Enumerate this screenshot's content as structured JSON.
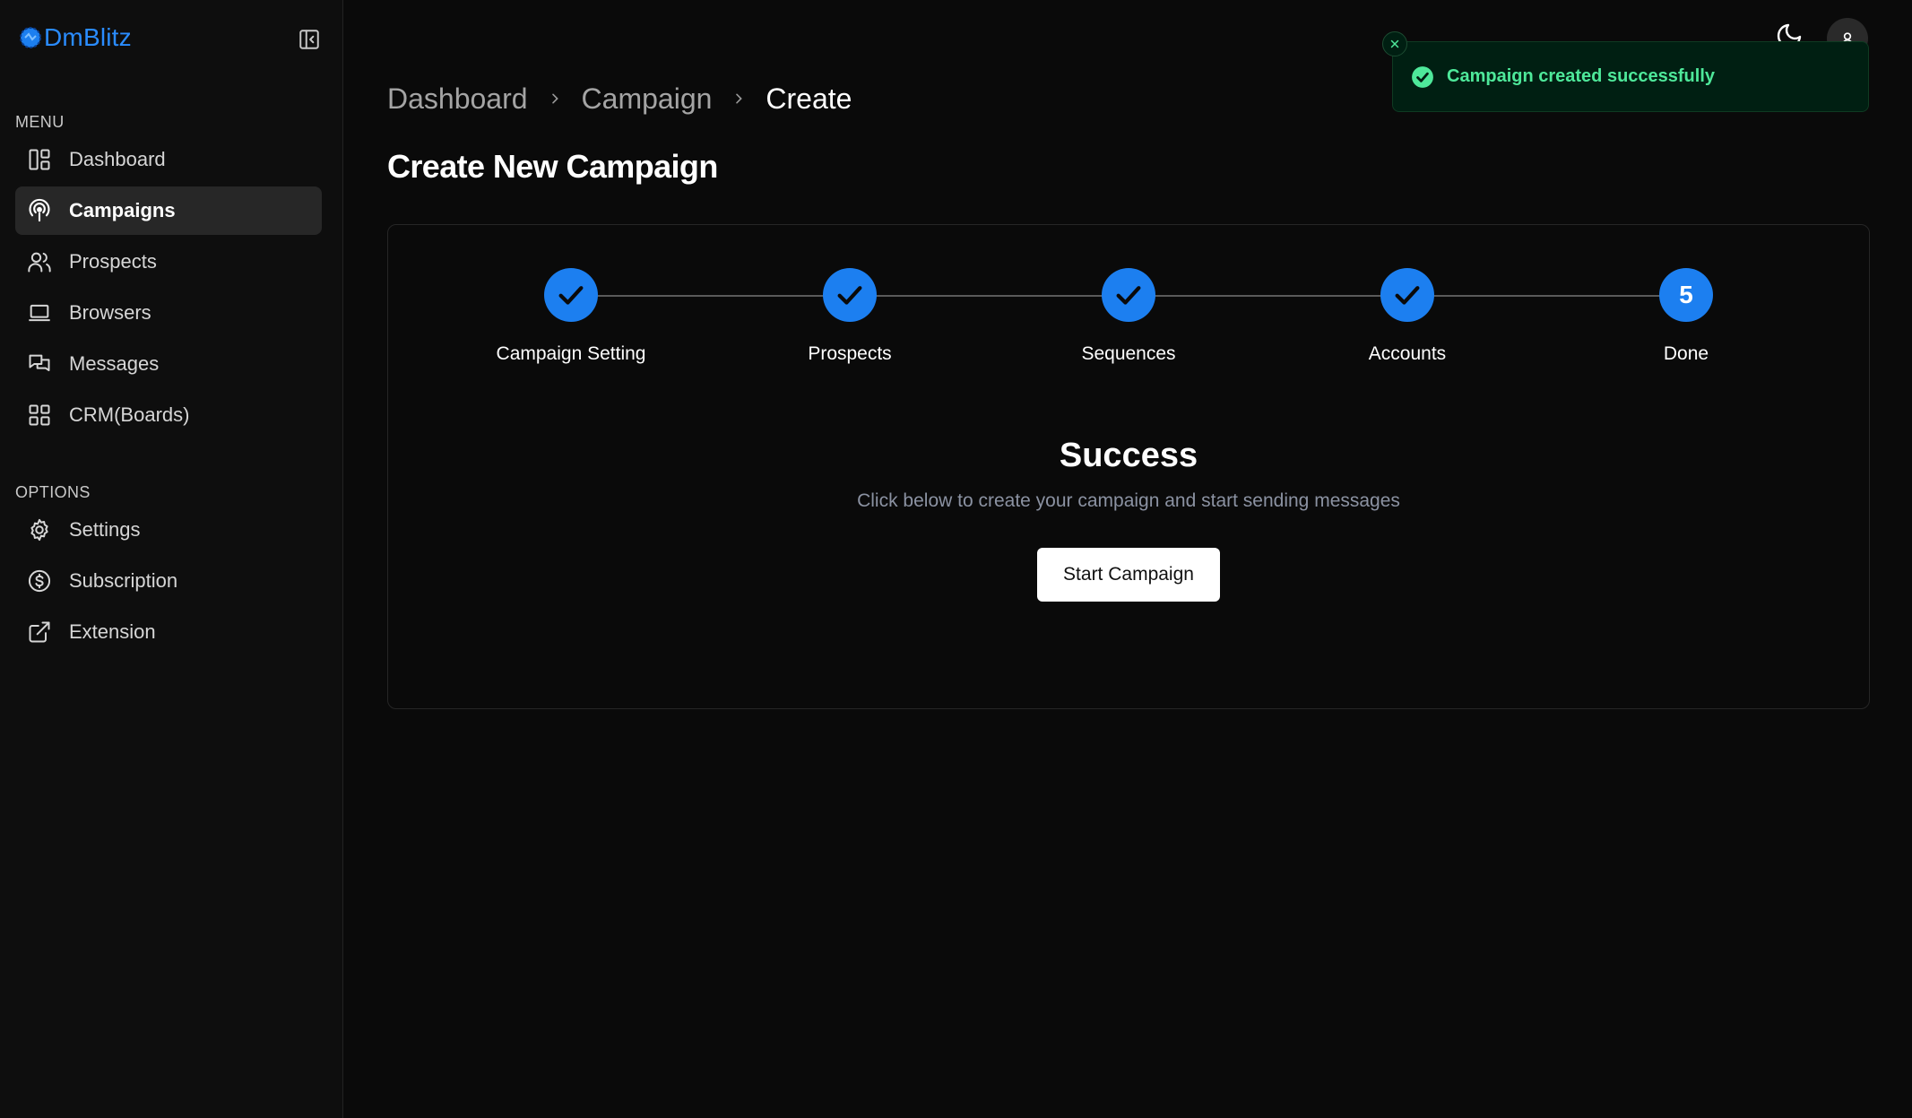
{
  "brand": {
    "name": "DmBlitz",
    "color": "#2a8cff"
  },
  "sidebar": {
    "menu_label": "MENU",
    "options_label": "OPTIONS",
    "menu_items": [
      {
        "label": "Dashboard",
        "icon": "layout-dashboard-icon",
        "active": false
      },
      {
        "label": "Campaigns",
        "icon": "podcast-icon",
        "active": true
      },
      {
        "label": "Prospects",
        "icon": "users-icon",
        "active": false
      },
      {
        "label": "Browsers",
        "icon": "laptop-icon",
        "active": false
      },
      {
        "label": "Messages",
        "icon": "messages-icon",
        "active": false
      },
      {
        "label": "CRM(Boards)",
        "icon": "grid-icon",
        "active": false
      }
    ],
    "option_items": [
      {
        "label": "Settings",
        "icon": "gear-icon"
      },
      {
        "label": "Subscription",
        "icon": "dollar-circle-icon"
      },
      {
        "label": "Extension",
        "icon": "external-link-icon"
      }
    ]
  },
  "breadcrumb": [
    "Dashboard",
    "Campaign",
    "Create"
  ],
  "page_title": "Create New Campaign",
  "toast": {
    "message": "Campaign created successfully",
    "color": "#4ee89a"
  },
  "stepper": {
    "accent": "#1c7ff0",
    "steps": [
      {
        "label": "Campaign Setting",
        "state": "complete",
        "mark": ""
      },
      {
        "label": "Prospects",
        "state": "complete",
        "mark": ""
      },
      {
        "label": "Sequences",
        "state": "complete",
        "mark": ""
      },
      {
        "label": "Accounts",
        "state": "complete",
        "mark": ""
      },
      {
        "label": "Done",
        "state": "current",
        "mark": "5"
      }
    ]
  },
  "success": {
    "title": "Success",
    "description": "Click below to create your campaign and start sending messages",
    "button_label": "Start Campaign"
  }
}
